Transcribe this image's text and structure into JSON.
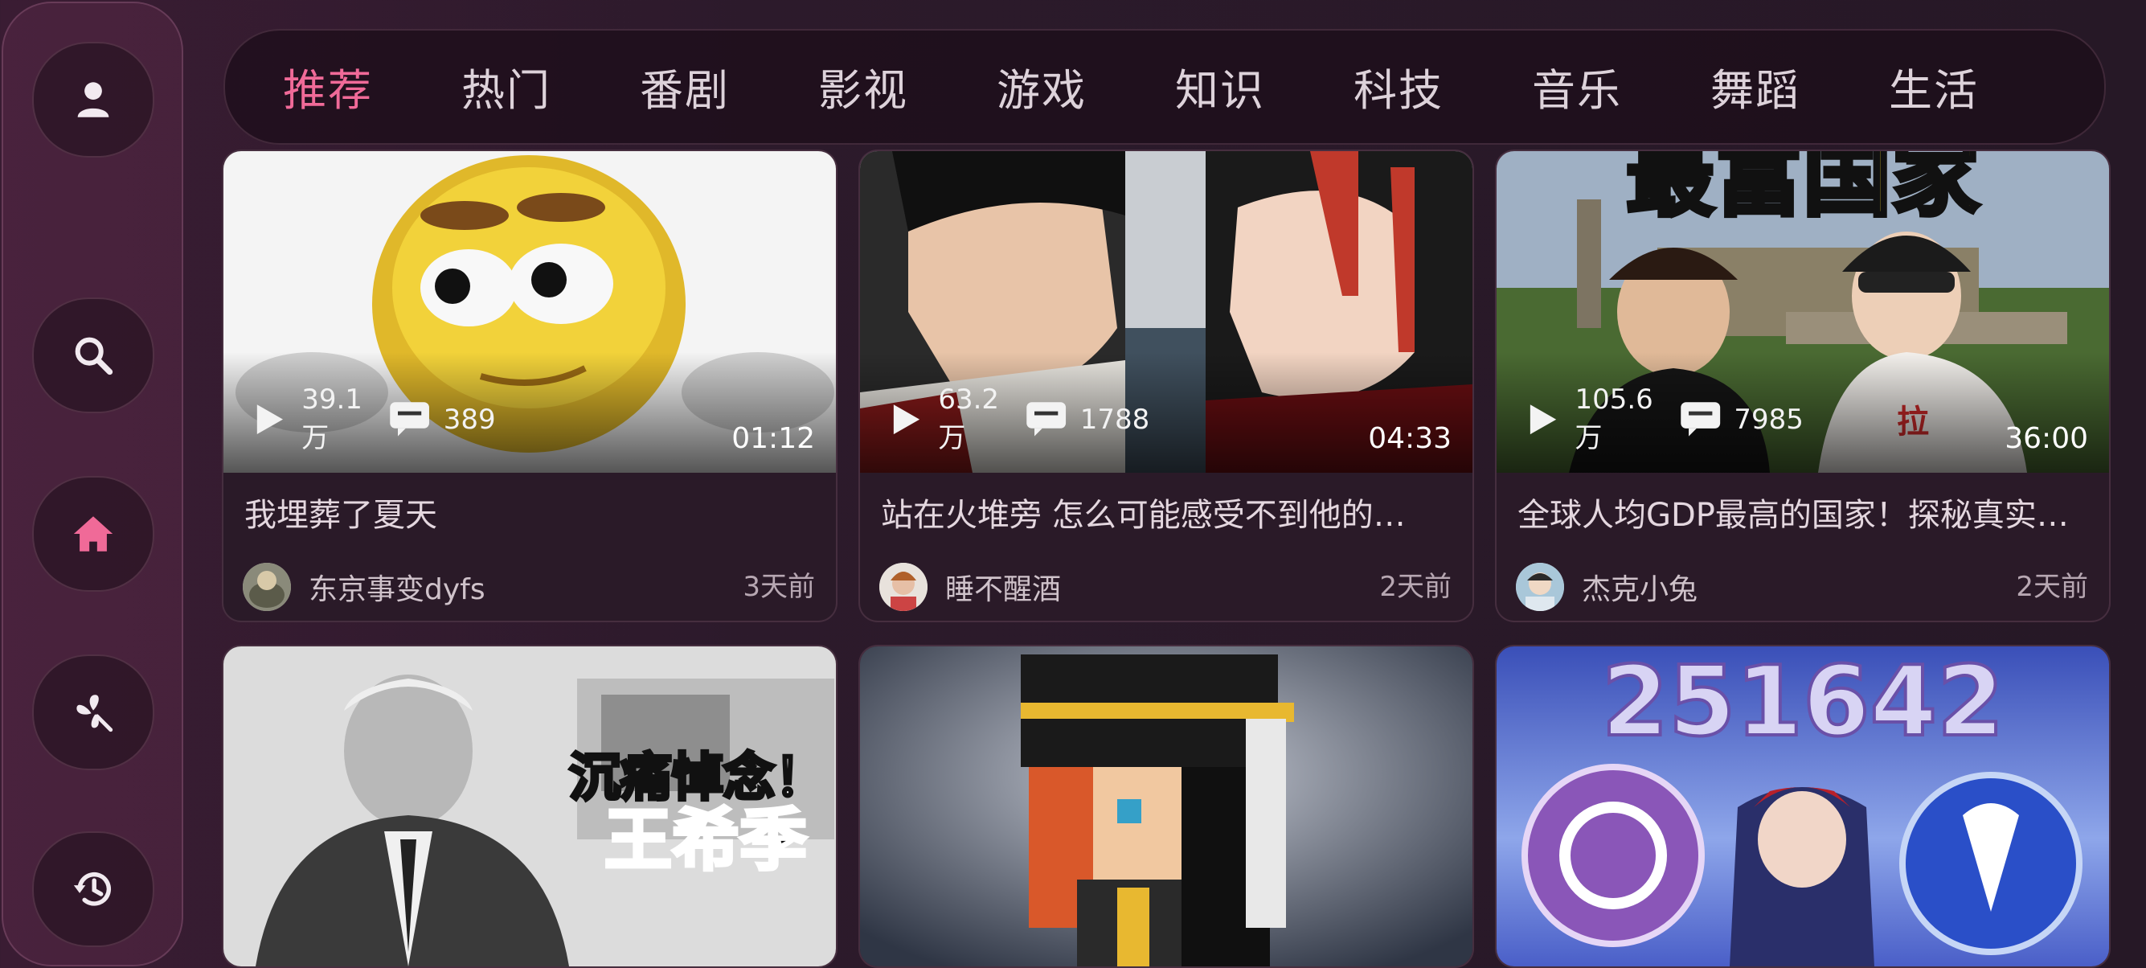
{
  "tabs": [
    "推荐",
    "热门",
    "番剧",
    "影视",
    "游戏",
    "知识",
    "科技",
    "音乐",
    "舞蹈",
    "生活"
  ],
  "sidebar": {
    "items": [
      {
        "icon": "user-icon"
      },
      {
        "icon": "search-icon"
      },
      {
        "icon": "home-icon",
        "active": true
      },
      {
        "icon": "pinwheel-icon"
      },
      {
        "icon": "history-icon"
      }
    ]
  },
  "colors": {
    "accent": "#f06a98"
  },
  "videos": [
    {
      "views": "39.1万",
      "danmaku": "389",
      "duration": "01:12",
      "title": "我埋葬了夏天",
      "author": "东京事变dyfs",
      "time": "3天前"
    },
    {
      "views": "63.2万",
      "danmaku": "1788",
      "duration": "04:33",
      "title": "站在火堆旁 怎么可能感受不到他的…",
      "author": "睡不醒酒",
      "time": "2天前"
    },
    {
      "views": "105.6万",
      "danmaku": "7985",
      "duration": "36:00",
      "title": "全球人均GDP最高的国家！探秘真实…",
      "author": "杰克小兔",
      "time": "2天前"
    }
  ],
  "thumb_texts": {
    "v3_banner": "最富国家",
    "v3_shirt": "拉",
    "v4_line1": "沉痛悼念！",
    "v4_line2": "王希季",
    "v6_number": "251642"
  }
}
